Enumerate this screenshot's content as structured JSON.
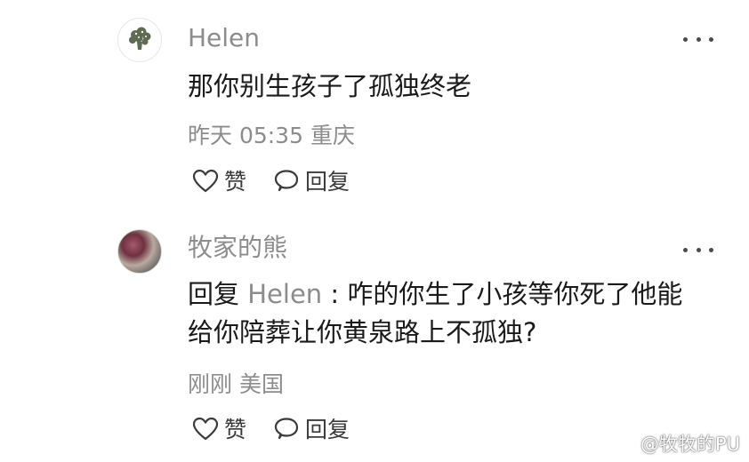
{
  "comments": [
    {
      "username": "Helen",
      "avatar": "broccoli-avatar",
      "text": "那你别生孩子了孤独终老",
      "date": "昨天 05:35",
      "location": "重庆",
      "like_label": "赞",
      "reply_label": "回复"
    },
    {
      "username": "牧家的熊",
      "avatar": "cat-photo-avatar",
      "reply_prefix": "回复",
      "reply_target": "Helen",
      "text_line1": ": 咋的你生了小孩等你死了他能",
      "text_line2": "给你陪葬让你黄泉路上不孤独?",
      "date": "刚刚",
      "location": "美国",
      "like_label": "赞",
      "reply_label": "回复"
    }
  ],
  "watermark": "@牧牧的PU",
  "colors": {
    "username": "#8c8c8c",
    "text": "#1a1a1a",
    "meta": "#8c8c8c",
    "icon": "#3a3a3a",
    "broccoli": "#5f6b52"
  }
}
